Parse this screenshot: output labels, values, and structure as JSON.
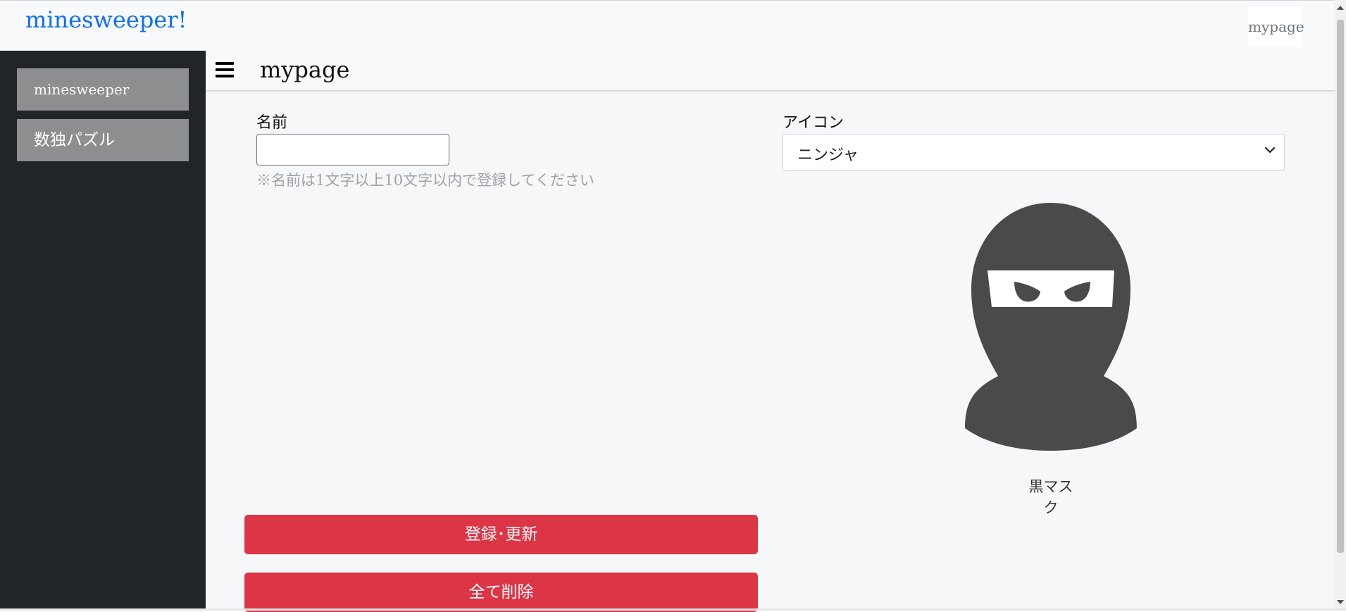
{
  "app": {
    "brand": "minesweeper!",
    "nav_mypage": "mypage",
    "brand_color": "#0d6efd"
  },
  "sidebar": {
    "items": [
      {
        "label": "minesweeper"
      },
      {
        "label": "数独パズル"
      }
    ]
  },
  "header": {
    "menu_icon": "hamburger-icon",
    "title": "mypage"
  },
  "form": {
    "name_label": "名前",
    "name_value": "",
    "name_hint": "※名前は1文字以上10文字以内で登録してください",
    "icon_label": "アイコン",
    "icon_selected": "ニンジャ",
    "icon_caption": "黒マスク",
    "icon_image": "ninja-avatar-icon",
    "save_button": "登録･更新",
    "delete_button": "全て削除",
    "button_color": "#dc3545"
  }
}
